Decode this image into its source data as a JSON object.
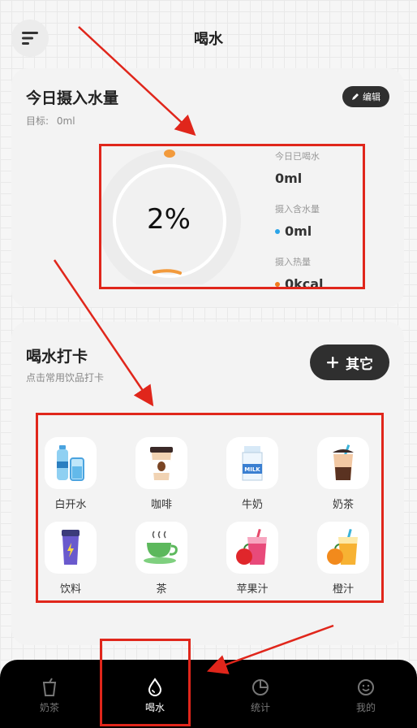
{
  "header": {
    "title": "喝水",
    "menu_icon": "menu-icon"
  },
  "intake_card": {
    "title": "今日摄入水量",
    "target_label": "目标:",
    "target_value": "0ml",
    "edit_label": "编辑",
    "edit_icon": "pencil-icon",
    "progress_text": "2%",
    "progress_fraction": 0.02,
    "ring_accent_color": "#f29a3c",
    "stats": [
      {
        "label": "今日已喝水",
        "value": "0ml"
      },
      {
        "label": "摄入含水量",
        "value": "0ml",
        "dot_color": "#2aa4e8"
      },
      {
        "label": "摄入热量",
        "value": "0kcal",
        "dot_color": "#f07a1c"
      }
    ]
  },
  "checkin_card": {
    "title": "喝水打卡",
    "subtitle": "点击常用饮品打卡",
    "other_button_label": "其它",
    "drinks": [
      {
        "label": "白开水",
        "icon": "water-bottle-icon"
      },
      {
        "label": "咖啡",
        "icon": "coffee-cup-icon"
      },
      {
        "label": "牛奶",
        "icon": "milk-carton-icon",
        "icon_text": "MILK"
      },
      {
        "label": "奶茶",
        "icon": "milk-tea-icon"
      },
      {
        "label": "饮料",
        "icon": "drink-can-icon"
      },
      {
        "label": "茶",
        "icon": "tea-cup-icon"
      },
      {
        "label": "苹果汁",
        "icon": "apple-juice-icon"
      },
      {
        "label": "橙汁",
        "icon": "orange-juice-icon"
      }
    ]
  },
  "tabbar": {
    "tabs": [
      {
        "label": "奶茶",
        "icon": "milk-tea-cup-icon",
        "active": false
      },
      {
        "label": "喝水",
        "icon": "water-drop-icon",
        "active": true
      },
      {
        "label": "统计",
        "icon": "pie-chart-icon",
        "active": false
      },
      {
        "label": "我的",
        "icon": "smiley-face-icon",
        "active": false
      }
    ]
  },
  "annotation_color": "#e0261b"
}
